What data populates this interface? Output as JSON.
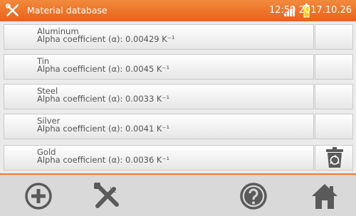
{
  "header": {
    "title": "Material database",
    "time": "12:59 2017.10.26"
  },
  "materials": [
    {
      "name": "Aluminum",
      "coefficient": "Alpha coefficient (α): 0.00429 K⁻¹"
    },
    {
      "name": "Tin",
      "coefficient": "Alpha coefficient (α): 0.0045 K⁻¹"
    },
    {
      "name": "Steel",
      "coefficient": "Alpha coefficient (α): 0.0033 K⁻¹"
    },
    {
      "name": "Silver",
      "coefficient": "Alpha coefficient (α): 0.0041 K⁻¹"
    },
    {
      "name": "Gold",
      "coefficient": "Alpha coefficient (α): 0.0036 K⁻¹"
    }
  ],
  "icons": {
    "header": "tools-icon",
    "signal": "signal-strength-icon",
    "battery": "battery-icon",
    "delete": "trash-icon",
    "add": "add-circle-icon",
    "settings": "tools-icon",
    "help": "help-icon",
    "home": "home-icon"
  },
  "colors": {
    "accent": "#ee6f22",
    "icon_gray": "#5a5a5a",
    "battery": "#ffcc00"
  }
}
